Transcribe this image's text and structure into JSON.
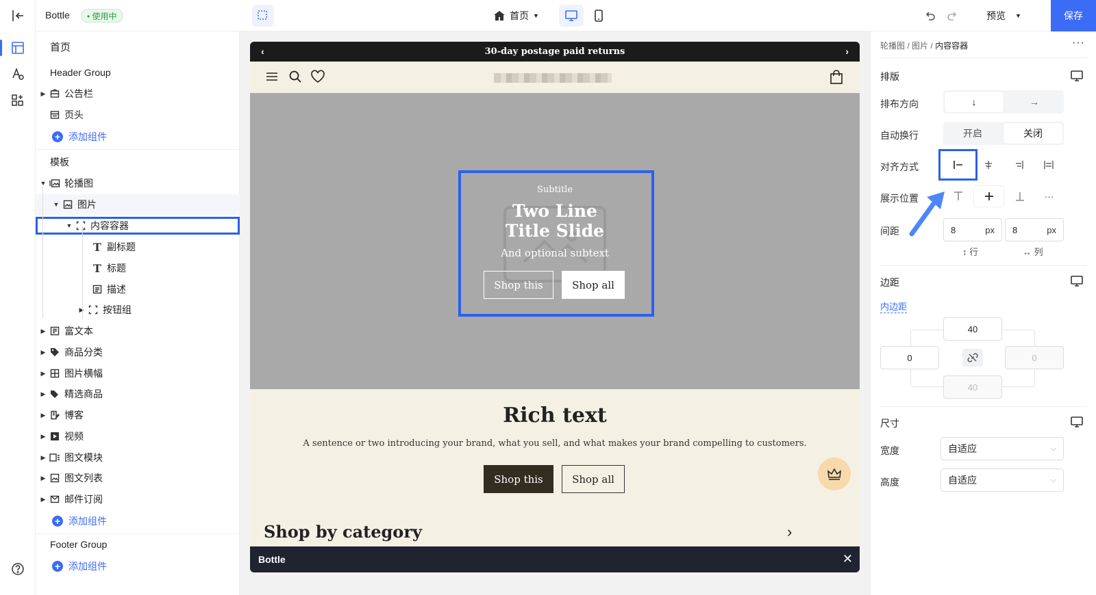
{
  "topbar": {
    "brand": "Bottle",
    "status_badge": "使用中",
    "page_name": "首页",
    "preview_label": "预览",
    "save_label": "保存"
  },
  "tree": {
    "page_title": "首页",
    "header_group": "Header Group",
    "announcement": "公告栏",
    "header": "页头",
    "add_component": "添加组件",
    "template": "模板",
    "carousel": "轮播图",
    "image": "图片",
    "content_container": "内容容器",
    "subtitle": "副标题",
    "title": "标题",
    "description": "描述",
    "button_group": "按钮组",
    "sections": [
      "富文本",
      "商品分类",
      "图片横幅",
      "精选商品",
      "博客",
      "视频",
      "图文模块",
      "图文列表",
      "邮件订阅"
    ],
    "footer_group": "Footer Group"
  },
  "canvas": {
    "announcement_text": "30-day postage paid returns",
    "hero": {
      "subtitle": "Subtitle",
      "title_line1": "Two Line",
      "title_line2": "Title Slide",
      "subtext": "And optional subtext",
      "btn1": "Shop this",
      "btn2": "Shop all"
    },
    "rich": {
      "heading": "Rich text",
      "body": "A sentence or two introducing your brand, what you sell, and what makes your brand compelling to customers.",
      "btn1": "Shop this",
      "btn2": "Shop all"
    },
    "shop_by_category": "Shop by category",
    "bottom_bar": "Bottle"
  },
  "panel": {
    "breadcrumb": [
      "轮播图",
      "图片",
      "内容容器"
    ],
    "layout_heading": "排版",
    "direction_label": "排布方向",
    "wrap_label": "自动换行",
    "wrap_on": "开启",
    "wrap_off": "关闭",
    "align_label": "对齐方式",
    "position_label": "展示位置",
    "gap_label": "间距",
    "gap_row": "8",
    "gap_col": "8",
    "unit": "px",
    "row_hint": "行",
    "col_hint": "列",
    "margin_heading": "边距",
    "padding_tab": "内边距",
    "padding_top": "40",
    "padding_left": "0",
    "padding_right": "0",
    "padding_bottom": "40",
    "size_heading": "尺寸",
    "width_label": "宽度",
    "width_value": "自适应",
    "height_label": "高度",
    "height_value": "自适应"
  }
}
